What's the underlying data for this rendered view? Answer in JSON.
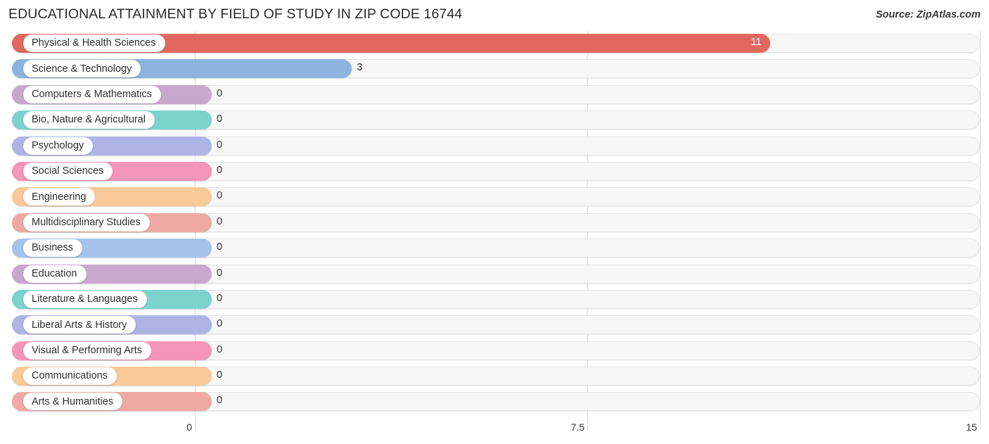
{
  "header": {
    "title": "EDUCATIONAL ATTAINMENT BY FIELD OF STUDY IN ZIP CODE 16744",
    "source": "Source: ZipAtlas.com"
  },
  "chart_data": {
    "type": "bar",
    "orientation": "horizontal",
    "title": "EDUCATIONAL ATTAINMENT BY FIELD OF STUDY IN ZIP CODE 16744",
    "subtitle": "Source: ZipAtlas.com",
    "xlabel": "",
    "ylabel": "",
    "xlim": [
      0,
      15
    ],
    "xticks": [
      0,
      7.5,
      15
    ],
    "xtick_labels": [
      "0",
      "7.5",
      "15"
    ],
    "grid": true,
    "legend": false,
    "categories": [
      "Physical & Health Sciences",
      "Science & Technology",
      "Computers & Mathematics",
      "Bio, Nature & Agricultural",
      "Psychology",
      "Social Sciences",
      "Engineering",
      "Multidisciplinary Studies",
      "Business",
      "Education",
      "Literature & Languages",
      "Liberal Arts & History",
      "Visual & Performing Arts",
      "Communications",
      "Arts & Humanities"
    ],
    "values": [
      11,
      3,
      0,
      0,
      0,
      0,
      0,
      0,
      0,
      0,
      0,
      0,
      0,
      0,
      0
    ],
    "value_labels": [
      "11",
      "3",
      "0",
      "0",
      "0",
      "0",
      "0",
      "0",
      "0",
      "0",
      "0",
      "0",
      "0",
      "0",
      "0"
    ],
    "colors": [
      "#e2685f",
      "#8db4de",
      "#c9a8cd",
      "#7cd3cd",
      "#aeb4e6",
      "#f595b8",
      "#fac999",
      "#efa9a5",
      "#a5c3ea",
      "#c9a8cd",
      "#7cd3cd",
      "#aeb4e6",
      "#f595b8",
      "#fac999",
      "#efa9a5"
    ]
  }
}
